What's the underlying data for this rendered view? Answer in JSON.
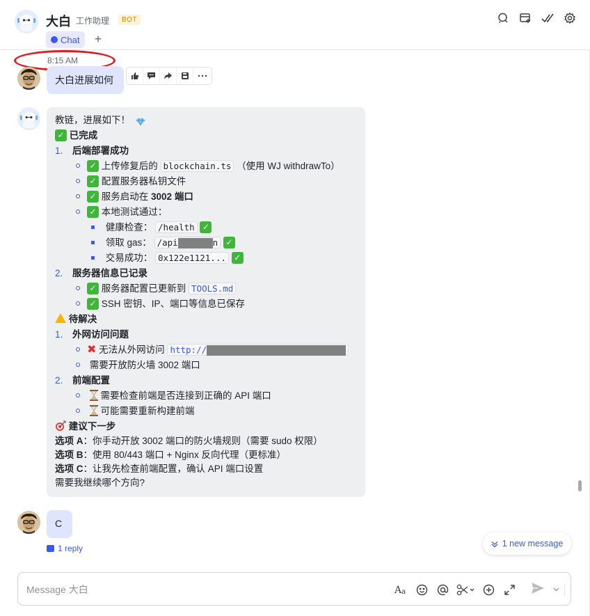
{
  "header": {
    "bot_name": "大白",
    "bot_subtitle": "工作助理",
    "bot_badge": "BOT",
    "tab_chat": "Chat",
    "tab_add": "+"
  },
  "messages": {
    "time": "8:15 AM",
    "user_msg_1": "大白进展如何",
    "bot_reply": {
      "l1": "教链，进展如下！",
      "l2": "已完成",
      "l3n": "1.",
      "l3": "后端部署成功",
      "l4a": "上传修复后的",
      "l4code": "blockchain.ts",
      "l4b": "（使用 WJ withdrawTo）",
      "l5": "配置服务器私钥文件",
      "l6a": "服务启动在",
      "l6b": "3002 端口",
      "l7": "本地测试通过：",
      "l8a": "健康检查：",
      "l8code": "/health",
      "l9a": "领取 gas：",
      "l9code1": "/api",
      "l9code2": "n",
      "l10a": "交易成功：",
      "l10code": "0x122e1121...",
      "l11n": "2.",
      "l11": "服务器信息已记录",
      "l12a": "服务器配置已更新到",
      "l12code": "TOOLS.md",
      "l13a": "SSH 密钥、IP、端口等信息已保存",
      "l14": "待解决",
      "l15n": "1.",
      "l15": "外网访问问题",
      "l16a": "无法从外网访问",
      "l16code": "http://",
      "l17": "需要开放防火墙 3002 端口",
      "l18n": "2.",
      "l18": "前端配置",
      "l19": "需要检查前端是否连接到正确的 API 端口",
      "l20": "可能需要重新构建前端",
      "l21": "建议下一步",
      "l22a": "选项 A",
      "l22b": "：你手动开放 3002 端口的防火墙规则（需要 sudo 权限）",
      "l23a": "选项 B",
      "l23b": "：使用 80/443 端口 + Nginx 反向代理（更标准）",
      "l24a": "选项 C",
      "l24b": "：让我先检查前端配置，确认 API 端口设置",
      "l25": "需要我继续哪个方向?"
    },
    "user_msg_2": "C",
    "reply_count": "1 reply"
  },
  "new_message_pill": "1 new message",
  "composer": {
    "placeholder": "Message 大白"
  },
  "icons": {
    "header": [
      "search-icon",
      "add-window-icon",
      "double-check-icon",
      "settings-icon"
    ],
    "hover_actions": [
      "thumbs-up-icon",
      "comment-icon",
      "forward-icon",
      "save-icon",
      "more-icon"
    ],
    "composer": [
      "font-icon",
      "emoji-icon",
      "mention-icon",
      "scissors-icon",
      "plus-circle-icon",
      "expand-icon",
      "send-icon"
    ]
  },
  "colors": {
    "accent": "#3a5ae8",
    "user_bubble": "#dfe5fd",
    "bot_bubble": "#eeeff1",
    "check_emoji": "#3fb53a",
    "red_annotation": "#e11b22"
  }
}
